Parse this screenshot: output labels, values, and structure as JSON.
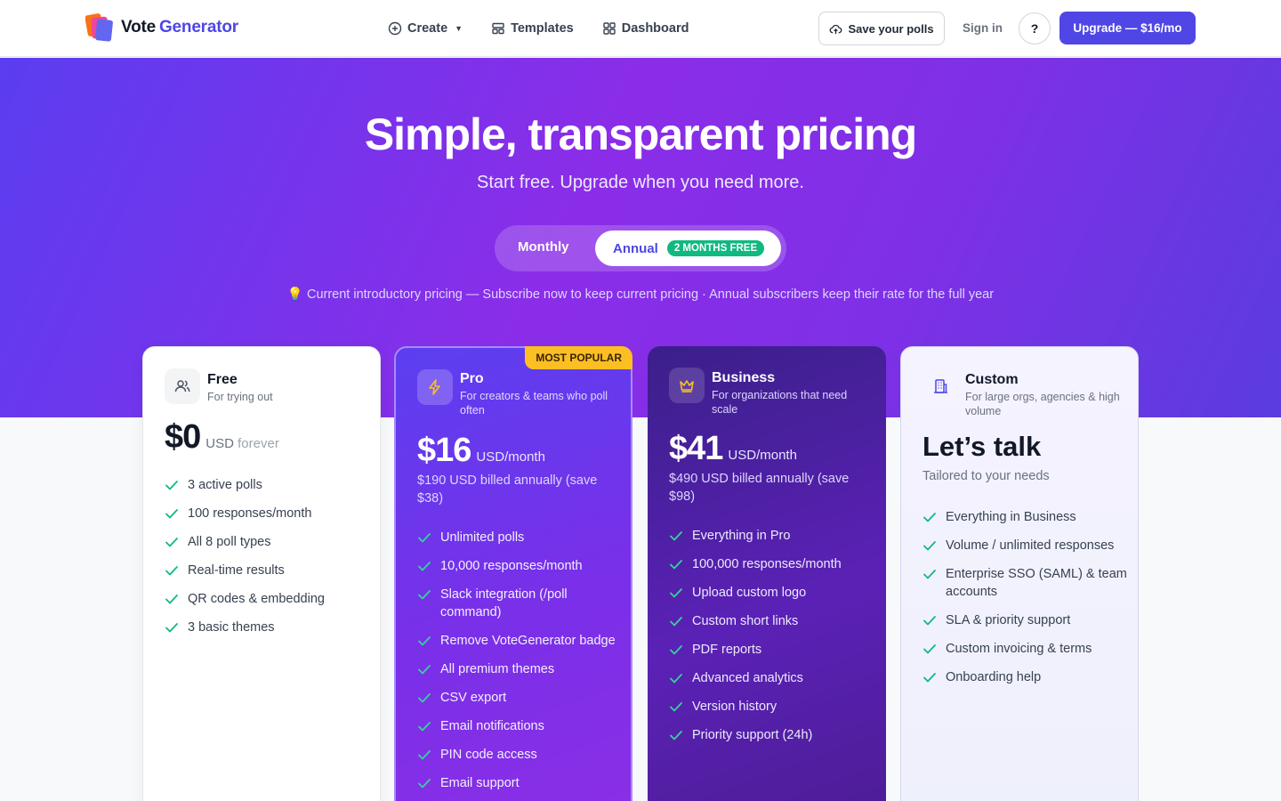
{
  "nav": {
    "logo_word1": "Vote",
    "logo_word2": "Generator",
    "links": [
      {
        "label": "Create",
        "icon": "plus-circle-icon"
      },
      {
        "label": "Templates",
        "icon": "templates-icon"
      },
      {
        "label": "Dashboard",
        "icon": "dashboard-icon"
      }
    ],
    "save_label": "Save your polls",
    "signin_label": "Sign in",
    "help_label": "?",
    "upgrade_label": "Upgrade — $16/mo"
  },
  "hero": {
    "title": "Simple, transparent pricing",
    "subtitle": "Start free. Upgrade when you need more.",
    "toggle_monthly": "Monthly",
    "toggle_annual": "Annual",
    "toggle_badge": "2 MONTHS FREE",
    "notice": "💡 Current introductory pricing — Subscribe now to keep current pricing · Annual subscribers keep their rate for the full year"
  },
  "plans": [
    {
      "name": "Free",
      "desc": "For trying out",
      "icon": "users-icon",
      "amount": "$0",
      "unit_a": "USD",
      "unit_b": "forever",
      "features": [
        "3 active polls",
        "100 responses/month",
        "All 8 poll types",
        "Real-time results",
        "QR codes & embedding",
        "3 basic themes"
      ]
    },
    {
      "name": "Pro",
      "desc": "For creators & teams who poll often",
      "icon": "lightning-icon",
      "badge": "MOST POPULAR",
      "amount": "$16",
      "unit": "USD/month",
      "billed": "$190 USD billed annually (save $38)",
      "features": [
        "Unlimited polls",
        "10,000 responses/month",
        "Slack integration (/poll command)",
        "Remove VoteGenerator badge",
        "All premium themes",
        "CSV export",
        "Email notifications",
        "PIN code access",
        "Email support"
      ]
    },
    {
      "name": "Business",
      "desc": "For organizations that need scale",
      "icon": "crown-icon",
      "amount": "$41",
      "unit": "USD/month",
      "billed": "$490 USD billed annually (save $98)",
      "features": [
        "Everything in Pro",
        "100,000 responses/month",
        "Upload custom logo",
        "Custom short links",
        "PDF reports",
        "Advanced analytics",
        "Version history",
        "Priority support (24h)"
      ]
    },
    {
      "name": "Custom",
      "desc": "For large orgs, agencies & high volume",
      "icon": "building-icon",
      "headline": "Let’s talk",
      "tagline": "Tailored to your needs",
      "features": [
        "Everything in Business",
        "Volume / unlimited responses",
        "Enterprise SSO (SAML) & team accounts",
        "SLA & priority support",
        "Custom invoicing & terms",
        "Onboarding help"
      ]
    }
  ],
  "colors": {
    "brand": "#4f46e5",
    "check_green": "#10b981",
    "popular_badge": "#fbbf24"
  }
}
